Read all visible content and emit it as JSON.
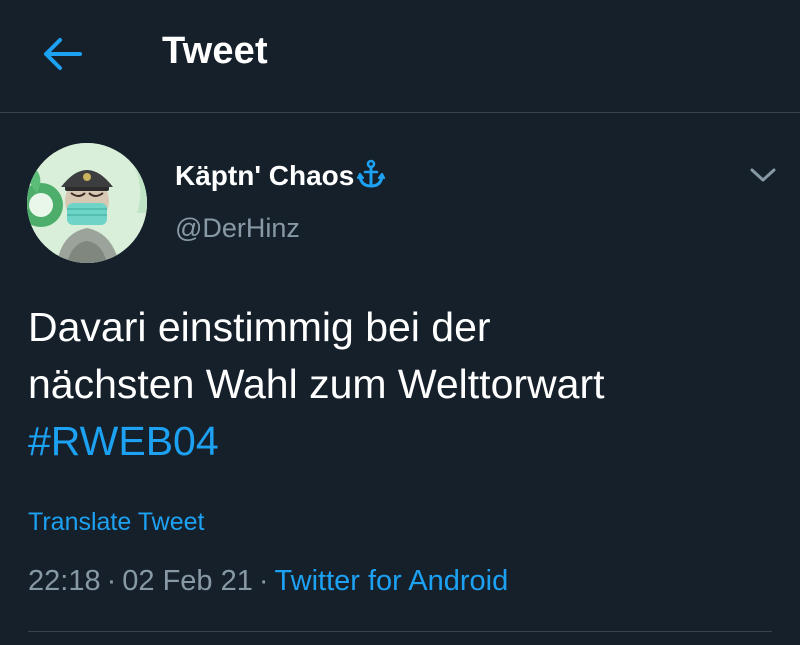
{
  "header": {
    "title": "Tweet",
    "back_icon": "arrow-left-icon",
    "accent_color": "#1da1f2"
  },
  "tweet": {
    "display_name": "Käptn' Chaos",
    "name_emoji_icon": "anchor-icon",
    "handle": "@DerHinz",
    "menu_icon": "chevron-down-icon",
    "text_lines": [
      "Davari einstimmig bei der",
      "nächsten Wahl zum Welttorwart"
    ],
    "hashtag": "#RWEB04",
    "translate_label": "Translate Tweet",
    "time": "22:18",
    "separator": "·",
    "date": "02 Feb 21",
    "source": "Twitter for Android"
  },
  "colors": {
    "background": "#15202b",
    "secondary_text": "#8899a6",
    "divider": "#38444d",
    "link": "#1da1f2"
  }
}
